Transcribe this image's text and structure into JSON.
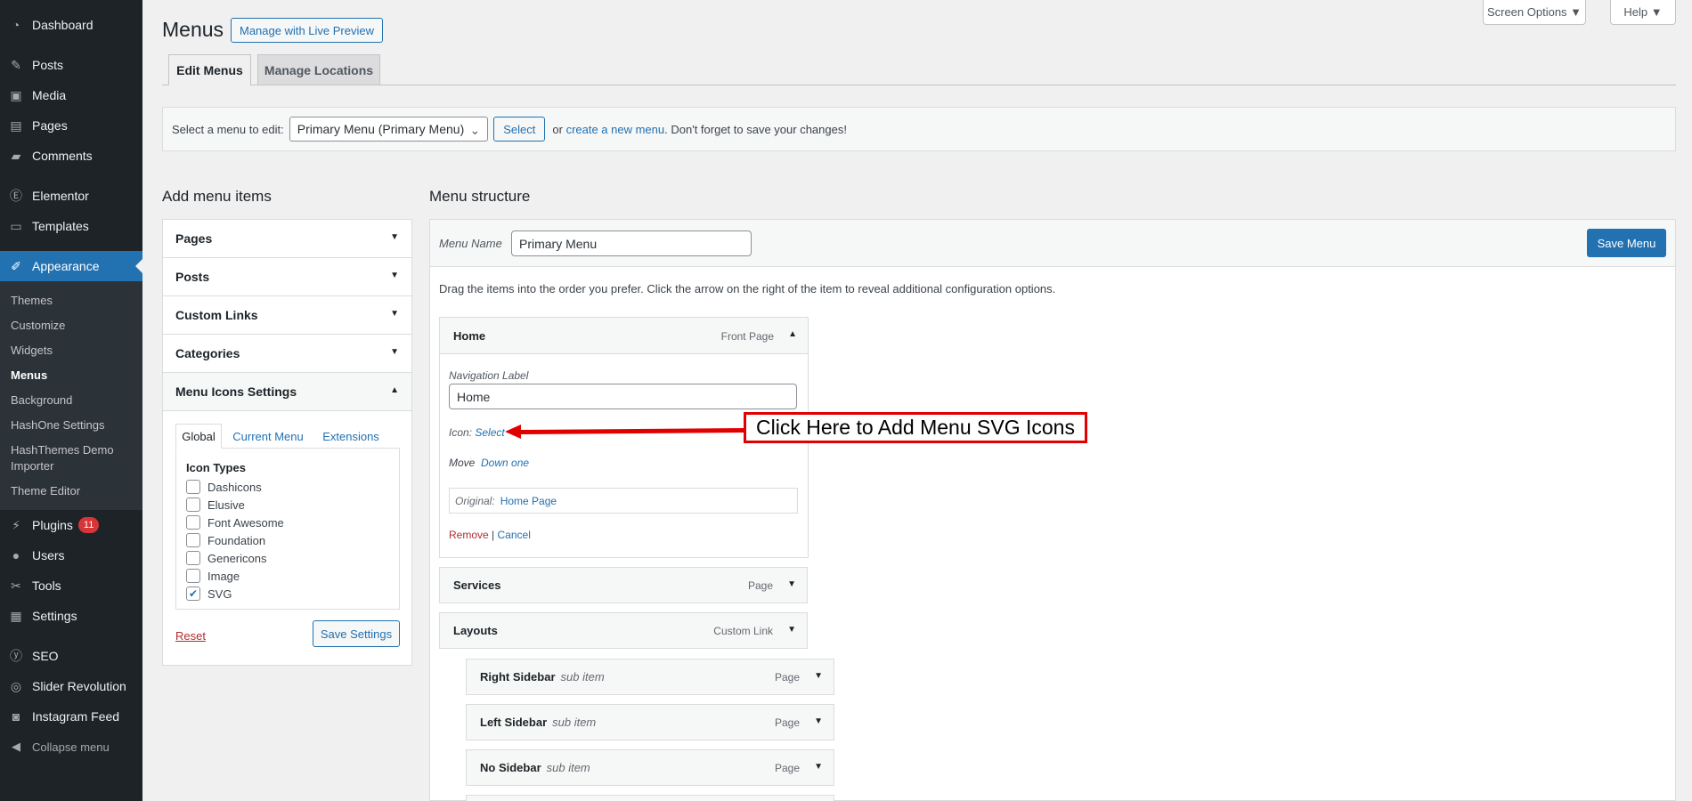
{
  "sidebar": {
    "items": [
      {
        "label": "Dashboard",
        "icon": "dashboard-icon"
      },
      {
        "label": "Posts",
        "icon": "pin-icon"
      },
      {
        "label": "Media",
        "icon": "media-icon"
      },
      {
        "label": "Pages",
        "icon": "pages-icon"
      },
      {
        "label": "Comments",
        "icon": "comments-icon"
      },
      {
        "label": "Elementor",
        "icon": "elementor-icon"
      },
      {
        "label": "Templates",
        "icon": "folder-icon"
      },
      {
        "label": "Appearance",
        "icon": "brush-icon"
      },
      {
        "label": "Plugins",
        "icon": "plugin-icon",
        "badge": "11"
      },
      {
        "label": "Users",
        "icon": "users-icon"
      },
      {
        "label": "Tools",
        "icon": "wrench-icon"
      },
      {
        "label": "Settings",
        "icon": "settings-icon"
      },
      {
        "label": "SEO",
        "icon": "yoast-icon"
      },
      {
        "label": "Slider Revolution",
        "icon": "slider-revolution-icon"
      },
      {
        "label": "Instagram Feed",
        "icon": "camera-icon"
      },
      {
        "label": "Collapse menu",
        "icon": "collapse-icon"
      }
    ],
    "appearance_sub": [
      "Themes",
      "Customize",
      "Widgets",
      "Menus",
      "Background",
      "HashOne Settings",
      "HashThemes Demo Importer",
      "Theme Editor"
    ]
  },
  "header": {
    "title": "Menus",
    "live_preview": "Manage with Live Preview",
    "screen_options": "Screen Options ▼",
    "help": "Help ▼",
    "tabs": [
      "Edit Menus",
      "Manage Locations"
    ]
  },
  "select_bar": {
    "label": "Select a menu to edit:",
    "selected": "Primary Menu (Primary Menu)",
    "select_btn": "Select",
    "or": "or",
    "create_link": "create a new menu",
    "tail": ". Don't forget to save your changes!"
  },
  "add_items": {
    "heading": "Add menu items",
    "sections": [
      "Pages",
      "Posts",
      "Custom Links",
      "Categories",
      "Menu Icons Settings"
    ],
    "icon_tabs": [
      "Global",
      "Current Menu",
      "Extensions"
    ],
    "icon_types_label": "Icon Types",
    "icon_types": [
      {
        "label": "Dashicons",
        "checked": false
      },
      {
        "label": "Elusive",
        "checked": false
      },
      {
        "label": "Font Awesome",
        "checked": false
      },
      {
        "label": "Foundation",
        "checked": false
      },
      {
        "label": "Genericons",
        "checked": false
      },
      {
        "label": "Image",
        "checked": false
      },
      {
        "label": "SVG",
        "checked": true
      }
    ],
    "reset": "Reset",
    "save_settings": "Save Settings"
  },
  "structure": {
    "heading": "Menu structure",
    "menu_name_label": "Menu Name",
    "menu_name_value": "Primary Menu",
    "save_menu": "Save Menu",
    "instructions": "Drag the items into the order you prefer. Click the arrow on the right of the item to reveal additional configuration options.",
    "open_item": {
      "title": "Home",
      "type": "Front Page",
      "nav_label": "Navigation Label",
      "nav_value": "Home",
      "icon_label": "Icon:",
      "icon_select": "Select",
      "move_label": "Move",
      "move_link": "Down one",
      "original_label": "Original:",
      "original_link": "Home Page",
      "remove": "Remove",
      "sep": "|",
      "cancel": "Cancel"
    },
    "items": [
      {
        "title": "Services",
        "type": "Page"
      },
      {
        "title": "Layouts",
        "type": "Custom Link"
      }
    ],
    "subitems": [
      {
        "title": "Right Sidebar",
        "sub": "sub item",
        "type": "Page"
      },
      {
        "title": "Left Sidebar",
        "sub": "sub item",
        "type": "Page"
      },
      {
        "title": "No Sidebar",
        "sub": "sub item",
        "type": "Page"
      }
    ]
  },
  "annotation": {
    "callout": "Click Here to Add Menu SVG Icons",
    "color": "#e00000"
  }
}
